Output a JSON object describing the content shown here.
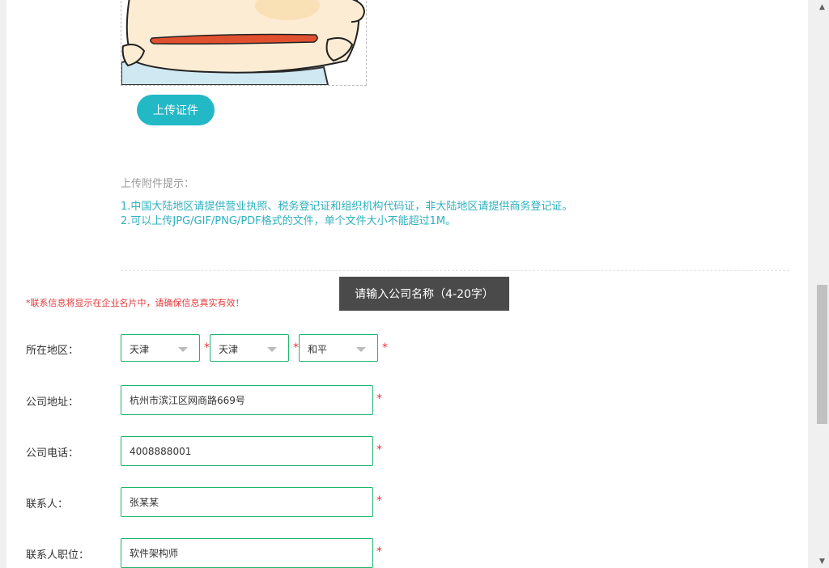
{
  "upload": {
    "button_label": "上传证件"
  },
  "tips": {
    "title": "上传附件提示：",
    "lines": [
      "1.中国大陆地区请提供营业执照、税务登记证和组织机构代码证，非大陆地区请提供商务登记证。",
      "2.可以上传JPG/GIF/PNG/PDF格式的文件，单个文件大小不能超过1M。"
    ]
  },
  "tooltip": "请输入公司名称（4-20字）",
  "notice": "*联系信息将显示在企业名片中，请确保信息真实有效！",
  "required_mark": "*",
  "form": {
    "region": {
      "label": "所在地区：",
      "province": "天津",
      "city": "天津",
      "district": "和平"
    },
    "address": {
      "label": "公司地址：",
      "value": "杭州市滨江区网商路669号"
    },
    "phone": {
      "label": "公司电话：",
      "value": "4008888001"
    },
    "contact": {
      "label": "联系人：",
      "value": "张某某"
    },
    "position": {
      "label": "联系人职位：",
      "value": "软件架构师"
    }
  },
  "scrollbar": {
    "up_icon": "▲",
    "down_icon": "▼"
  },
  "colors": {
    "accent": "#23b8c6",
    "border": "#1db56b",
    "required": "#e4393c",
    "tip_text": "#2fb1bf"
  }
}
